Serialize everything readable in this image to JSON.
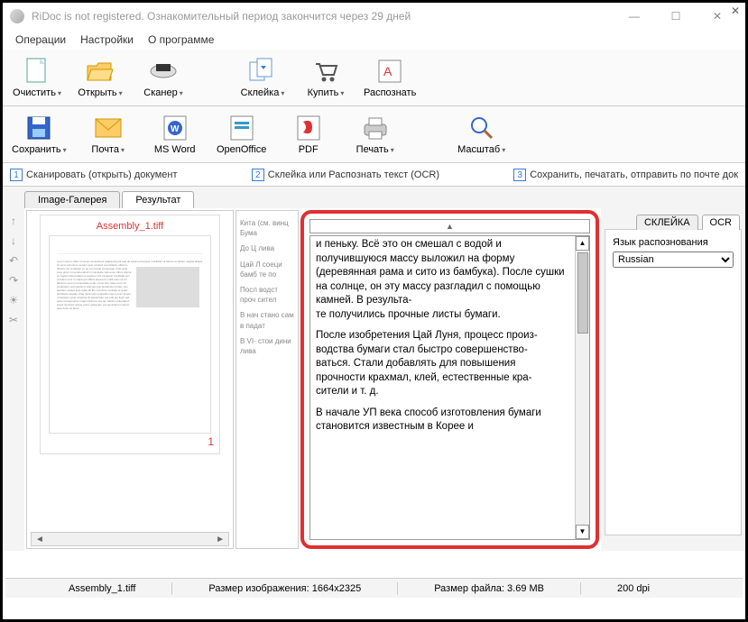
{
  "window": {
    "title": "RiDoc is not registered. Ознакомительный период закончится через 29 дней"
  },
  "menu": {
    "operations": "Операции",
    "settings": "Настройки",
    "about": "О программе"
  },
  "toolbar1": {
    "clear": "Очистить",
    "open": "Открыть",
    "scanner": "Сканер",
    "glue": "Склейка",
    "buy": "Купить",
    "recognize": "Распознать"
  },
  "toolbar2": {
    "save": "Сохранить",
    "mail": "Почта",
    "word": "MS Word",
    "ooffice": "OpenOffice",
    "pdf": "PDF",
    "print": "Печать",
    "zoom": "Масштаб"
  },
  "steps": {
    "s1": "Сканировать (открыть) документ",
    "s2": "Склейка или Распознать текст (OCR)",
    "s3": "Сохранить, печатать, отправить по почте док"
  },
  "tabs": {
    "gallery": "Image-Галерея",
    "result": "Результат"
  },
  "thumb": {
    "title": "Assembly_1.tiff",
    "page": "1"
  },
  "right_tabs": {
    "glue": "СКЛЕЙКА",
    "ocr": "OCR"
  },
  "ocr_panel": {
    "lang_label": "Язык распознования",
    "lang_value": "Russian"
  },
  "ocr_text": {
    "p1": "и пеньку. Всё это он смешал с водой и получившуюся массу выложил на форму (деревянная рама и сито из бамбука). После сушки на солнце, он эту массу разгладил с помощью камней. В результа-\nте получились прочные листы бумаги.",
    "p2": "После изобретения Цай Луня, процесс произ-\nводства бумаги стал быстро совершенство-\nваться. Стали добавлять для повышения\nпрочности крахмал, клей, естественные кра-\nсители и т. д.",
    "p3": "В начале УП века способ изготовления бумаги становится известным в Корее и"
  },
  "status": {
    "file": "Assembly_1.tiff",
    "size_label": "Размер изображения:",
    "size_val": "1664x2325",
    "fsize_label": "Размер файла:",
    "fsize_val": "3.69 MB",
    "dpi": "200 dpi"
  },
  "preview_text": {
    "a": "Кита (см. винц Бума",
    "b": "До Ц лива",
    "c": "Цай Л соеци бамб те по",
    "d": "Посл водст проч сител",
    "e": "В нач стано сам в падат",
    "f": "В VI- стои дини лива"
  }
}
